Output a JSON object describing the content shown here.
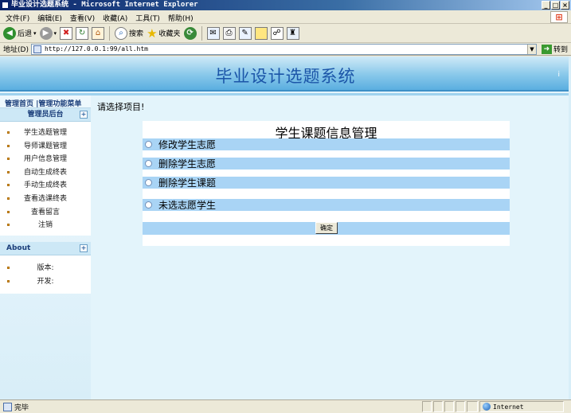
{
  "window": {
    "title": "毕业设计选题系统 - Microsoft Internet Explorer",
    "controls": [
      "_",
      "□",
      "×"
    ]
  },
  "menu": {
    "items": [
      "文件(F)",
      "编辑(E)",
      "查看(V)",
      "收藏(A)",
      "工具(T)",
      "帮助(H)"
    ]
  },
  "toolbar": {
    "back_label": "后退",
    "search_label": "搜索",
    "favorites_label": "收藏夹"
  },
  "address": {
    "label": "地址(D)",
    "url": "http://127.0.0.1:99/all.htm",
    "go_label": "转到"
  },
  "page": {
    "banner_title": "毕业设计选题系统",
    "banner_mark": "i",
    "prompt": "请选择项目!"
  },
  "sidebar": {
    "top_nav": "管理首页 |管理功能菜单",
    "admin_head": "管理员后台",
    "admin_items": [
      "学生选题管理",
      "导师课题管理",
      "用户信息管理",
      "自动生成终表",
      "手动生成终表",
      "查看选课终表",
      "查看留言",
      "注销"
    ],
    "about_head": "About",
    "about_items": [
      "版本:",
      "开发:"
    ],
    "toggle_symbol": "+"
  },
  "panel": {
    "title": "学生课题信息管理",
    "options": [
      "修改学生志愿",
      "删除学生志愿",
      "删除学生课题",
      "未选志愿学生"
    ],
    "submit_label": "确定"
  },
  "status": {
    "text": "完毕",
    "zone": "Internet"
  },
  "colors": {
    "banner_title": "#1b55a8",
    "row_highlight": "#a9d4f5",
    "page_background": "#e3f4fb"
  }
}
